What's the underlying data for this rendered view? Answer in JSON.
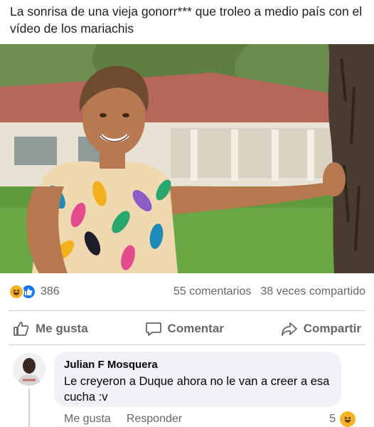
{
  "post": {
    "text": "La sonrisa de una vieja gonorr*** que troleo a medio país con el vídeo de los mariachis"
  },
  "photo": {
    "subject": "photo"
  },
  "summary": {
    "reaction_icons": [
      "haha-reaction-icon",
      "like-reaction-icon"
    ],
    "reaction_count": "386",
    "comments": "55 comentarios",
    "shares": "38 veces compartido"
  },
  "actions": {
    "like": "Me gusta",
    "comment": "Comentar",
    "share": "Compartir"
  },
  "comment": {
    "author": "Julian F Mosquera",
    "text": "Le creyeron a Duque ahora no le van a creer a esa cucha :v",
    "like": "Me gusta",
    "reply": "Responder",
    "reaction_count": "5",
    "reaction_icon": "haha-reaction-icon"
  },
  "colors": {
    "like_blue": "#1877f2",
    "haha_yellow": "#f7b125",
    "muted_text": "#65676b",
    "bubble_bg": "#f0f2f5"
  }
}
